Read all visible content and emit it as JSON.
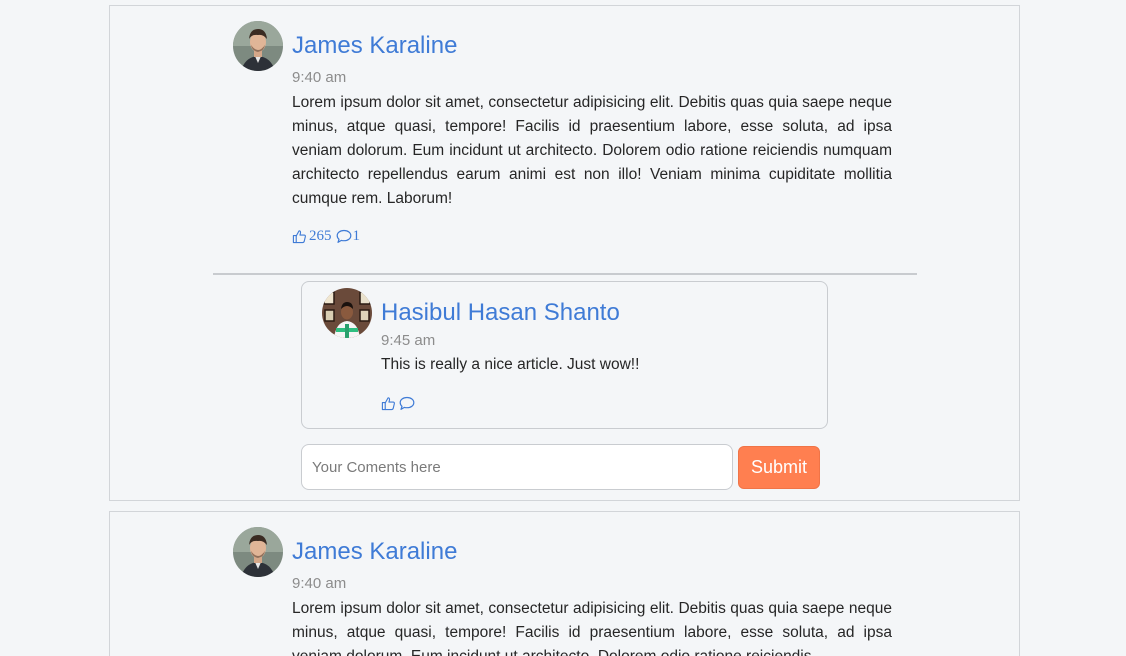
{
  "colors": {
    "accent": "#3f7bd6",
    "submit": "#ff7f50",
    "background": "#f4f6f8",
    "muted_text": "#8c8c8c"
  },
  "posts": [
    {
      "author": "James Karaline",
      "time": "9:40 am",
      "body": "Lorem ipsum dolor sit amet, consectetur adipisicing elit. Debitis quas quia saepe neque minus, atque quasi, tempore! Facilis id praesentium labore, esse soluta, ad ipsa veniam dolorum. Eum incidunt ut architecto. Dolorem odio ratione reiciendis numquam architecto repellendus earum animi est non illo! Veniam minima cupiditate mollitia cumque rem. Laborum!",
      "likes": "265",
      "comments": "1",
      "like_icon": "thumbs-up-icon",
      "comment_icon": "speech-bubble-icon",
      "comment": {
        "author": "Hasibul Hasan Shanto",
        "time": "9:45 am",
        "text": "This is really a nice article. Just wow!!"
      },
      "form": {
        "placeholder": "Your Coments here",
        "submit_label": "Submit"
      }
    },
    {
      "author": "James Karaline",
      "time": "9:40 am",
      "body": "Lorem ipsum dolor sit amet, consectetur adipisicing elit. Debitis quas quia saepe neque minus, atque quasi, tempore! Facilis id praesentium labore, esse soluta, ad ipsa veniam dolorum. Eum incidunt ut architecto. Dolorem odio ratione reiciendis"
    }
  ]
}
